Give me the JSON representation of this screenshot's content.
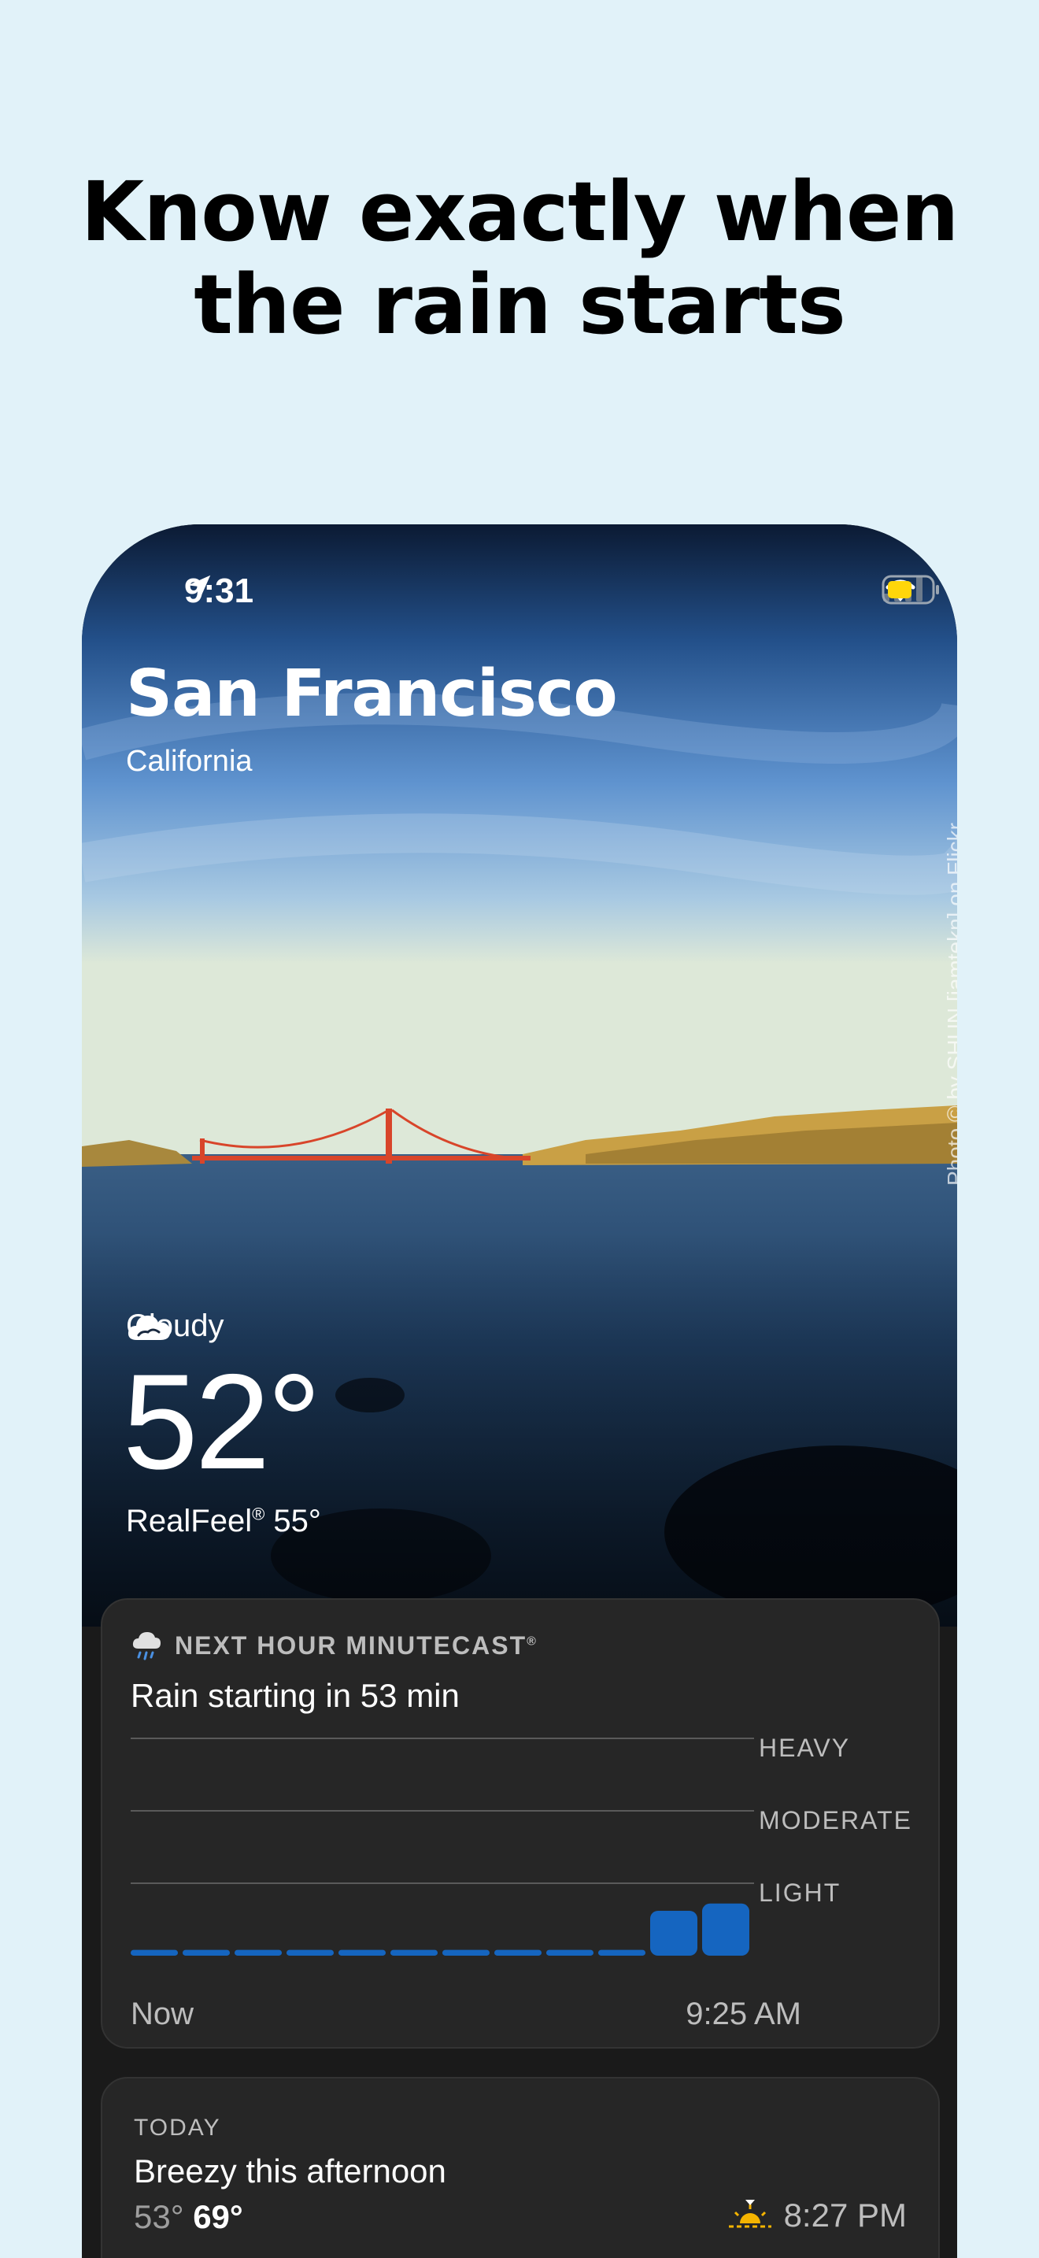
{
  "headline": {
    "line1": "Know exactly when",
    "line2": "the rain starts"
  },
  "status_bar": {
    "time": "9:31"
  },
  "location": {
    "city": "San Francisco",
    "region": "California"
  },
  "photo_credit": "Photo © by SHUN [iamtekn] on Flickr",
  "current": {
    "condition": "Cloudy",
    "temperature": "52°",
    "realfeel_label": "RealFeel",
    "realfeel_mark": "®",
    "realfeel_value": " 55°"
  },
  "minutecast": {
    "title": "NEXT HOUR MINUTECAST",
    "title_mark": "®",
    "summary": "Rain starting in 53 min",
    "levels": [
      "HEAVY",
      "MODERATE",
      "LIGHT"
    ],
    "time_start": "Now",
    "time_end": "9:25 AM",
    "accent": "#1565c0",
    "chart_data": {
      "type": "bar",
      "categories": [
        "1",
        "2",
        "3",
        "4",
        "5",
        "6",
        "7",
        "8",
        "9",
        "10",
        "11",
        "12"
      ],
      "values": [
        0.08,
        0.08,
        0.08,
        0.08,
        0.08,
        0.08,
        0.08,
        0.08,
        0.08,
        0.08,
        0.62,
        0.72
      ],
      "ylim": [
        0,
        3
      ],
      "grid": true
    }
  },
  "today": {
    "label": "TODAY",
    "summary": "Breezy this afternoon",
    "low": "53°",
    "high": "69°",
    "sunset": "8:27 PM",
    "sun_color": "#f5b400"
  }
}
